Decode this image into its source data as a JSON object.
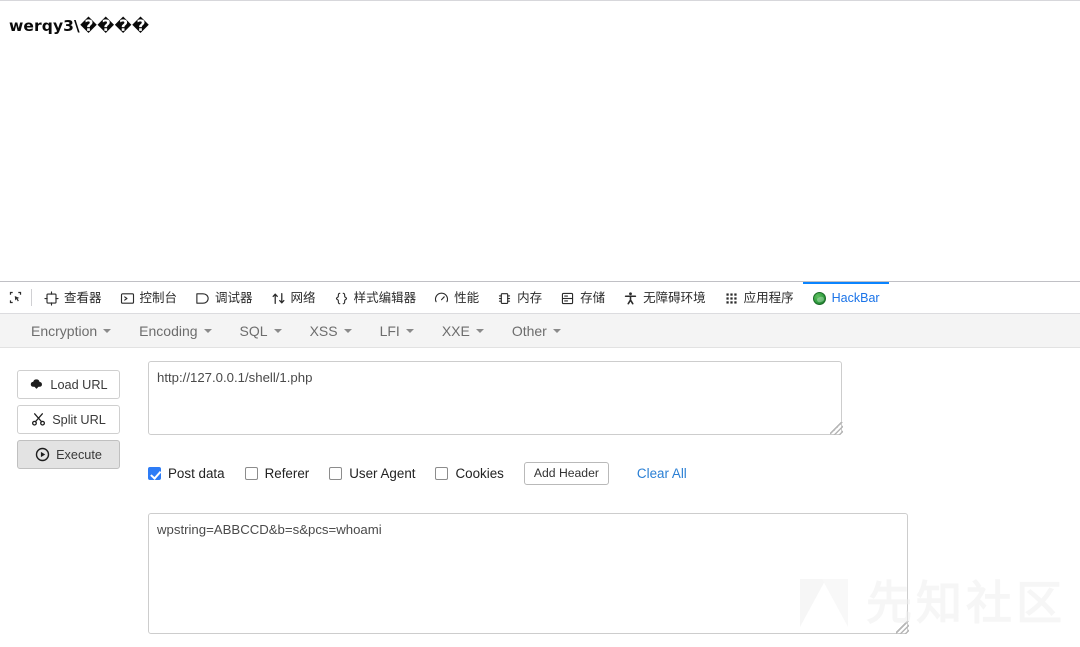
{
  "browser": {
    "page_content": "werqy3\\����"
  },
  "devtools": {
    "picker_icon": "element-picker-icon",
    "tabs": [
      {
        "label": "查看器",
        "icon": "inspector-icon",
        "active": false
      },
      {
        "label": "控制台",
        "icon": "console-icon",
        "active": false
      },
      {
        "label": "调试器",
        "icon": "debugger-icon",
        "active": false
      },
      {
        "label": "网络",
        "icon": "network-icon",
        "active": false
      },
      {
        "label": "样式编辑器",
        "icon": "style-editor-icon",
        "active": false
      },
      {
        "label": "性能",
        "icon": "performance-icon",
        "active": false
      },
      {
        "label": "内存",
        "icon": "memory-icon",
        "active": false
      },
      {
        "label": "存储",
        "icon": "storage-icon",
        "active": false
      },
      {
        "label": "无障碍环境",
        "icon": "accessibility-icon",
        "active": false
      },
      {
        "label": "应用程序",
        "icon": "application-icon",
        "active": false
      },
      {
        "label": "HackBar",
        "icon": "hackbar-icon",
        "active": true
      }
    ],
    "active_tab_accent": "#0a84ff"
  },
  "hackbar": {
    "menu": [
      {
        "label": "Encryption"
      },
      {
        "label": "Encoding"
      },
      {
        "label": "SQL"
      },
      {
        "label": "XSS"
      },
      {
        "label": "LFI"
      },
      {
        "label": "XXE"
      },
      {
        "label": "Other"
      }
    ],
    "actions": [
      {
        "label": "Load URL",
        "icon": "cloud-download-icon",
        "pressed": false
      },
      {
        "label": "Split URL",
        "icon": "scissors-icon",
        "pressed": false
      },
      {
        "label": "Execute",
        "icon": "play-circle-icon",
        "pressed": true
      }
    ],
    "url_field": {
      "value": "http://127.0.0.1/shell/1.php",
      "placeholder": ""
    },
    "options": [
      {
        "label": "Post data",
        "checked": true
      },
      {
        "label": "Referer",
        "checked": false
      },
      {
        "label": "User Agent",
        "checked": false
      },
      {
        "label": "Cookies",
        "checked": false
      }
    ],
    "add_header_label": "Add Header",
    "clear_all_label": "Clear All",
    "postdata_field": {
      "value": "wpstring=ABBCCD&b=s&pcs=whoami",
      "placeholder": ""
    },
    "link_color": "#2a7fd4",
    "checkbox_color": "#2d7cf6"
  },
  "watermark": {
    "text": "先知社区"
  }
}
